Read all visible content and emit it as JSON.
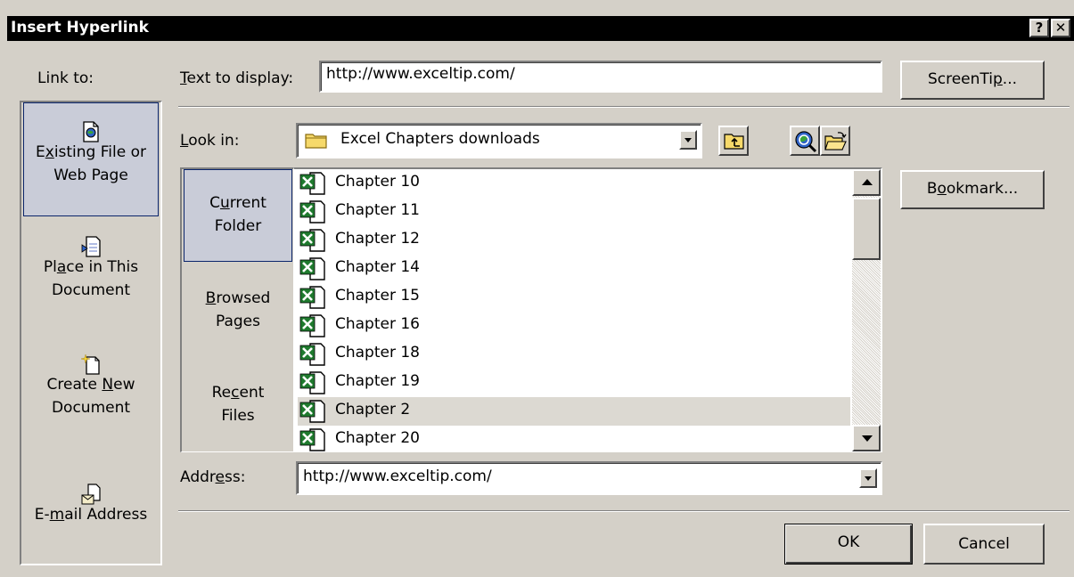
{
  "window": {
    "title": "Insert Hyperlink",
    "help_glyph": "?",
    "close_glyph": "✕"
  },
  "link_to": {
    "heading": "Link to:",
    "items": [
      {
        "label_parts": [
          "E",
          "x",
          "isting File or"
        ],
        "label_line2": "Web Page",
        "icon": "existing-file-icon",
        "selected": true
      },
      {
        "label_parts": [
          "Pl",
          "a",
          "ce in This"
        ],
        "label_line2": "Document",
        "icon": "place-in-document-icon",
        "selected": false
      },
      {
        "label_parts": [
          "Create ",
          "N",
          "ew"
        ],
        "label_line2": "Document",
        "icon": "new-document-icon",
        "selected": false
      },
      {
        "label_parts": [
          "E-",
          "m",
          "ail Address"
        ],
        "label_line2": "",
        "icon": "email-address-icon",
        "selected": false
      }
    ]
  },
  "text_to_display": {
    "label_parts": [
      "",
      "T",
      "ext to display:"
    ],
    "value": "http://www.exceltip.com/"
  },
  "screentip_button": {
    "label_parts": [
      "ScreenTi",
      "p",
      "..."
    ]
  },
  "look_in": {
    "label_parts": [
      "",
      "L",
      "ook in:"
    ],
    "value": "Excel Chapters downloads"
  },
  "toolbar": {
    "up_folder_icon": "up-one-folder-icon",
    "browse_web_icon": "browse-web-icon",
    "browse_file_icon": "browse-file-icon"
  },
  "nav": {
    "items": [
      {
        "label_parts": [
          "C",
          "u",
          "rrent"
        ],
        "label_line2": "Folder",
        "selected": true
      },
      {
        "label_parts": [
          "",
          "B",
          "rowsed"
        ],
        "label_line2": "Pages",
        "selected": false
      },
      {
        "label_parts": [
          "Re",
          "c",
          "ent"
        ],
        "label_line2": "Files",
        "selected": false
      }
    ]
  },
  "files": {
    "items": [
      {
        "name": "Chapter 10",
        "highlight": false
      },
      {
        "name": "Chapter 11",
        "highlight": false
      },
      {
        "name": "Chapter 12",
        "highlight": false
      },
      {
        "name": "Chapter 14",
        "highlight": false
      },
      {
        "name": "Chapter 15",
        "highlight": false
      },
      {
        "name": "Chapter 16",
        "highlight": false
      },
      {
        "name": "Chapter 18",
        "highlight": false
      },
      {
        "name": "Chapter 19",
        "highlight": false
      },
      {
        "name": "Chapter 2",
        "highlight": true
      },
      {
        "name": "Chapter 20",
        "highlight": false
      }
    ],
    "file_icon": "excel-file-icon"
  },
  "bookmark_button": {
    "label_parts": [
      "B",
      "o",
      "okmark..."
    ]
  },
  "address": {
    "label_parts": [
      "Addr",
      "e",
      "ss:"
    ],
    "value": "http://www.exceltip.com/"
  },
  "ok_button": {
    "label": "OK"
  },
  "cancel_button": {
    "label": "Cancel"
  },
  "colors": {
    "dialog_face": "#d4d0c8",
    "titlebar": "#000000",
    "selection_fill": "#c9ccd8",
    "selection_border": "#0a246a",
    "excel_green": "#1f7a2e"
  }
}
